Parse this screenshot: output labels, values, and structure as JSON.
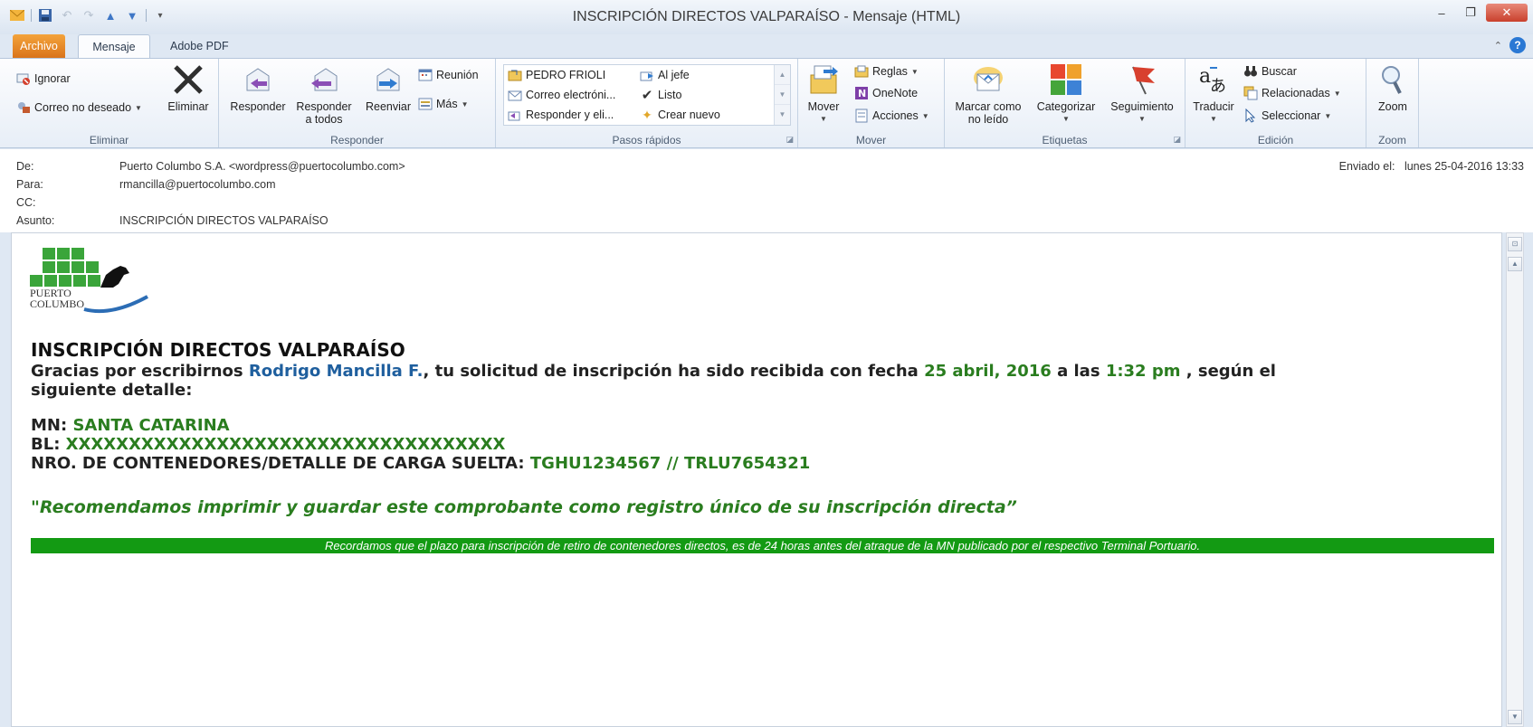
{
  "window": {
    "title": "INSCRIPCIÓN DIRECTOS VALPARAÍSO - Mensaje (HTML)"
  },
  "tabs": {
    "file": "Archivo",
    "message": "Mensaje",
    "adobe": "Adobe PDF"
  },
  "ribbon": {
    "eliminar": {
      "label": "Eliminar",
      "ignore": "Ignorar",
      "junk": "Correo no deseado",
      "delete": "Eliminar"
    },
    "responder": {
      "label": "Responder",
      "reply": "Responder",
      "reply_all_1": "Responder",
      "reply_all_2": "a todos",
      "forward": "Reenviar",
      "meeting": "Reunión",
      "more": "Más"
    },
    "pasos": {
      "label": "Pasos rápidos",
      "items": [
        "PEDRO FRIOLI",
        "Correo electróni...",
        "Responder y eli...",
        "Al jefe",
        "Listo",
        "Crear nuevo"
      ]
    },
    "mover": {
      "label": "Mover",
      "move": "Mover",
      "rules": "Reglas",
      "onenote": "OneNote",
      "actions": "Acciones"
    },
    "etiquetas": {
      "label": "Etiquetas",
      "unread_1": "Marcar como",
      "unread_2": "no leído",
      "categorize": "Categorizar",
      "followup": "Seguimiento"
    },
    "edicion": {
      "label": "Edición",
      "translate": "Traducir",
      "find": "Buscar",
      "related": "Relacionadas",
      "select": "Seleccionar"
    },
    "zoom": {
      "label": "Zoom",
      "zoom": "Zoom"
    }
  },
  "header": {
    "from_label": "De:",
    "from": "Puerto Columbo S.A. <wordpress@puertocolumbo.com>",
    "to_label": "Para:",
    "to": "rmancilla@puertocolumbo.com",
    "cc_label": "CC:",
    "subject_label": "Asunto:",
    "subject": "INSCRIPCIÓN DIRECTOS VALPARAÍSO",
    "sent_label": "Enviado el:",
    "sent": "lunes 25-04-2016 13:33"
  },
  "body": {
    "logo_text_1": "PUERTO",
    "logo_text_2": "COLUMBO",
    "title": "INSCRIPCIÓN DIRECTOS VALPARAÍSO",
    "greeting_1": "Gracias por escribirnos ",
    "name": "Rodrigo Mancilla F.",
    "greeting_2": ", tu solicitud de inscripción ha sido recibida con fecha ",
    "date": "25 abril, 2016",
    "greeting_3": " a las ",
    "time": "1:32 pm",
    "greeting_4": " , según el",
    "greeting_5": "siguiente detalle:",
    "mn_label": "MN: ",
    "mn_value": "SANTA CATARINA",
    "bl_label": "BL: ",
    "bl_value": "XXXXXXXXXXXXXXXXXXXXXXXXXXXXXXXXXXX",
    "nro_label": "NRO. DE CONTENEDORES/DETALLE DE CARGA SUELTA: ",
    "nro_value": "TGHU1234567 // TRLU7654321",
    "quote": "\"Recomendamos imprimir y guardar este comprobante como registro único de su inscripción directa”",
    "banner": "Recordamos que el plazo para inscripción de retiro de contenedores directos, es de 24 horas antes del atraque de la MN publicado por el respectivo Terminal Portuario."
  },
  "colors": {
    "green_text": "#2a7d1f",
    "blue_text": "#1f5f9e",
    "banner_bg": "#139a13",
    "file_tab": "#e8861f"
  }
}
